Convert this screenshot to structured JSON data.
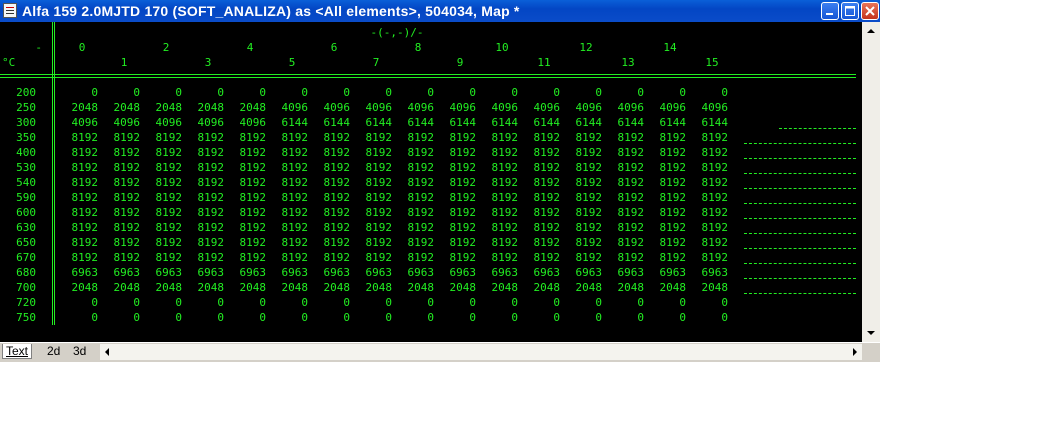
{
  "window": {
    "title": "Alfa 159 2.0MJTD 170 (SOFT_ANALIZA) as <All elements>, 504034, Map *"
  },
  "map": {
    "axis_caption": "-(-,-)/-",
    "corner_top": "-",
    "corner_unit": "°C",
    "columns": [
      "0",
      "1",
      "2",
      "3",
      "4",
      "5",
      "6",
      "7",
      "8",
      "9",
      "10",
      "11",
      "12",
      "13",
      "14",
      "15"
    ],
    "rows": [
      {
        "label": "200",
        "values": [
          "0",
          "0",
          "0",
          "0",
          "0",
          "0",
          "0",
          "0",
          "0",
          "0",
          "0",
          "0",
          "0",
          "0",
          "0",
          "0"
        ]
      },
      {
        "label": "250",
        "values": [
          "2048",
          "2048",
          "2048",
          "2048",
          "2048",
          "4096",
          "4096",
          "4096",
          "4096",
          "4096",
          "4096",
          "4096",
          "4096",
          "4096",
          "4096",
          "4096"
        ]
      },
      {
        "label": "300",
        "values": [
          "4096",
          "4096",
          "4096",
          "4096",
          "4096",
          "6144",
          "6144",
          "6144",
          "6144",
          "6144",
          "6144",
          "6144",
          "6144",
          "6144",
          "6144",
          "6144"
        ]
      },
      {
        "label": "350",
        "values": [
          "8192",
          "8192",
          "8192",
          "8192",
          "8192",
          "8192",
          "8192",
          "8192",
          "8192",
          "8192",
          "8192",
          "8192",
          "8192",
          "8192",
          "8192",
          "8192"
        ]
      },
      {
        "label": "400",
        "values": [
          "8192",
          "8192",
          "8192",
          "8192",
          "8192",
          "8192",
          "8192",
          "8192",
          "8192",
          "8192",
          "8192",
          "8192",
          "8192",
          "8192",
          "8192",
          "8192"
        ]
      },
      {
        "label": "530",
        "values": [
          "8192",
          "8192",
          "8192",
          "8192",
          "8192",
          "8192",
          "8192",
          "8192",
          "8192",
          "8192",
          "8192",
          "8192",
          "8192",
          "8192",
          "8192",
          "8192"
        ]
      },
      {
        "label": "540",
        "values": [
          "8192",
          "8192",
          "8192",
          "8192",
          "8192",
          "8192",
          "8192",
          "8192",
          "8192",
          "8192",
          "8192",
          "8192",
          "8192",
          "8192",
          "8192",
          "8192"
        ]
      },
      {
        "label": "590",
        "values": [
          "8192",
          "8192",
          "8192",
          "8192",
          "8192",
          "8192",
          "8192",
          "8192",
          "8192",
          "8192",
          "8192",
          "8192",
          "8192",
          "8192",
          "8192",
          "8192"
        ]
      },
      {
        "label": "600",
        "values": [
          "8192",
          "8192",
          "8192",
          "8192",
          "8192",
          "8192",
          "8192",
          "8192",
          "8192",
          "8192",
          "8192",
          "8192",
          "8192",
          "8192",
          "8192",
          "8192"
        ]
      },
      {
        "label": "630",
        "values": [
          "8192",
          "8192",
          "8192",
          "8192",
          "8192",
          "8192",
          "8192",
          "8192",
          "8192",
          "8192",
          "8192",
          "8192",
          "8192",
          "8192",
          "8192",
          "8192"
        ]
      },
      {
        "label": "650",
        "values": [
          "8192",
          "8192",
          "8192",
          "8192",
          "8192",
          "8192",
          "8192",
          "8192",
          "8192",
          "8192",
          "8192",
          "8192",
          "8192",
          "8192",
          "8192",
          "8192"
        ]
      },
      {
        "label": "670",
        "values": [
          "8192",
          "8192",
          "8192",
          "8192",
          "8192",
          "8192",
          "8192",
          "8192",
          "8192",
          "8192",
          "8192",
          "8192",
          "8192",
          "8192",
          "8192",
          "8192"
        ]
      },
      {
        "label": "680",
        "values": [
          "6963",
          "6963",
          "6963",
          "6963",
          "6963",
          "6963",
          "6963",
          "6963",
          "6963",
          "6963",
          "6963",
          "6963",
          "6963",
          "6963",
          "6963",
          "6963"
        ]
      },
      {
        "label": "700",
        "values": [
          "2048",
          "2048",
          "2048",
          "2048",
          "2048",
          "2048",
          "2048",
          "2048",
          "2048",
          "2048",
          "2048",
          "2048",
          "2048",
          "2048",
          "2048",
          "2048"
        ]
      },
      {
        "label": "720",
        "values": [
          "0",
          "0",
          "0",
          "0",
          "0",
          "0",
          "0",
          "0",
          "0",
          "0",
          "0",
          "0",
          "0",
          "0",
          "0",
          "0"
        ]
      },
      {
        "label": "750",
        "values": [
          "0",
          "0",
          "0",
          "0",
          "0",
          "0",
          "0",
          "0",
          "0",
          "0",
          "0",
          "0",
          "0",
          "0",
          "0",
          "0"
        ]
      }
    ]
  },
  "tabs": [
    {
      "label": "Text",
      "active": true
    },
    {
      "label": "2d",
      "active": false
    },
    {
      "label": "3d",
      "active": false
    }
  ],
  "colors": {
    "text_green": "#22ee22",
    "background": "#000000",
    "titlebar": "#0a4cc9"
  },
  "icons": [
    "app-icon",
    "minimize-icon",
    "maximize-icon",
    "close-icon",
    "scroll-up-icon",
    "scroll-down-icon",
    "scroll-left-icon",
    "scroll-right-icon"
  ]
}
